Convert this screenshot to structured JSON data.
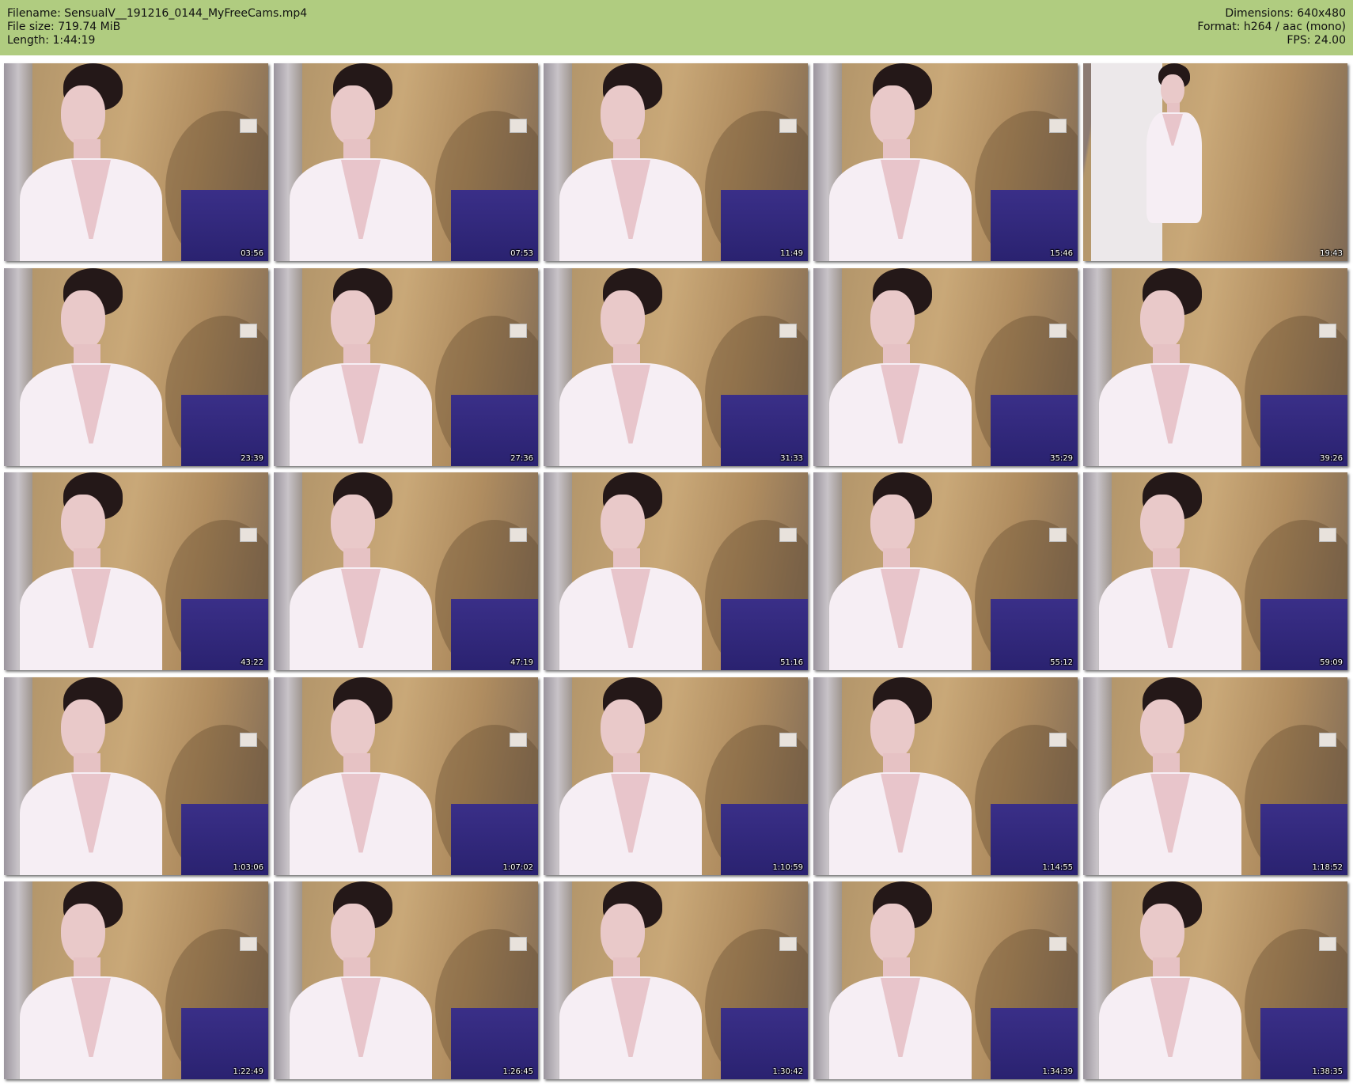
{
  "header": {
    "filename": "Filename: SensualV__191216_0144_MyFreeCams.mp4",
    "filesize": "File size: 719.74 MiB",
    "length": "Length: 1:44:19",
    "dimensions": "Dimensions: 640x480",
    "format": "Format: h264 / aac (mono)",
    "fps": "FPS: 24.00"
  },
  "thumbnails": [
    {
      "time": "03:56"
    },
    {
      "time": "07:53"
    },
    {
      "time": "11:49"
    },
    {
      "time": "15:46"
    },
    {
      "time": "19:43"
    },
    {
      "time": "23:39"
    },
    {
      "time": "27:36"
    },
    {
      "time": "31:33"
    },
    {
      "time": "35:29"
    },
    {
      "time": "39:26"
    },
    {
      "time": "43:22"
    },
    {
      "time": "47:19"
    },
    {
      "time": "51:16"
    },
    {
      "time": "55:12"
    },
    {
      "time": "59:09"
    },
    {
      "time": "1:03:06"
    },
    {
      "time": "1:07:02"
    },
    {
      "time": "1:10:59"
    },
    {
      "time": "1:14:55"
    },
    {
      "time": "1:18:52"
    },
    {
      "time": "1:22:49"
    },
    {
      "time": "1:26:45"
    },
    {
      "time": "1:30:42"
    },
    {
      "time": "1:34:39"
    },
    {
      "time": "1:38:35"
    }
  ],
  "colors": {
    "header_bg": "#b0cc80",
    "page_bg": "#ffffff"
  }
}
